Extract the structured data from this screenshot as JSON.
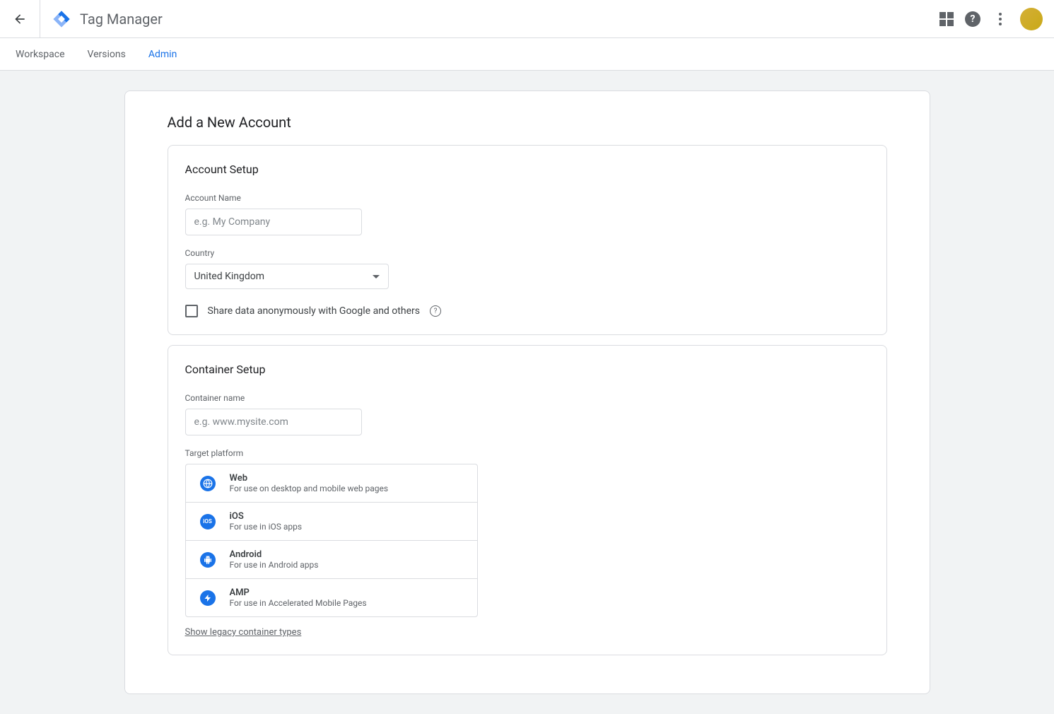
{
  "header": {
    "product_title": "Tag Manager"
  },
  "nav": {
    "tabs": [
      {
        "label": "Workspace",
        "active": false
      },
      {
        "label": "Versions",
        "active": false
      },
      {
        "label": "Admin",
        "active": true
      }
    ]
  },
  "page": {
    "heading": "Add a New Account"
  },
  "account_setup": {
    "title": "Account Setup",
    "name_label": "Account Name",
    "name_placeholder": "e.g. My Company",
    "name_value": "",
    "country_label": "Country",
    "country_value": "United Kingdom",
    "share_label": "Share data anonymously with Google and others"
  },
  "container_setup": {
    "title": "Container Setup",
    "name_label": "Container name",
    "name_placeholder": "e.g. www.mysite.com",
    "name_value": "",
    "target_label": "Target platform",
    "platforms": [
      {
        "name": "Web",
        "desc": "For use on desktop and mobile web pages",
        "icon": "globe"
      },
      {
        "name": "iOS",
        "desc": "For use in iOS apps",
        "icon": "ios"
      },
      {
        "name": "Android",
        "desc": "For use in Android apps",
        "icon": "android"
      },
      {
        "name": "AMP",
        "desc": "For use in Accelerated Mobile Pages",
        "icon": "bolt"
      }
    ],
    "legacy_link": "Show legacy container types"
  }
}
